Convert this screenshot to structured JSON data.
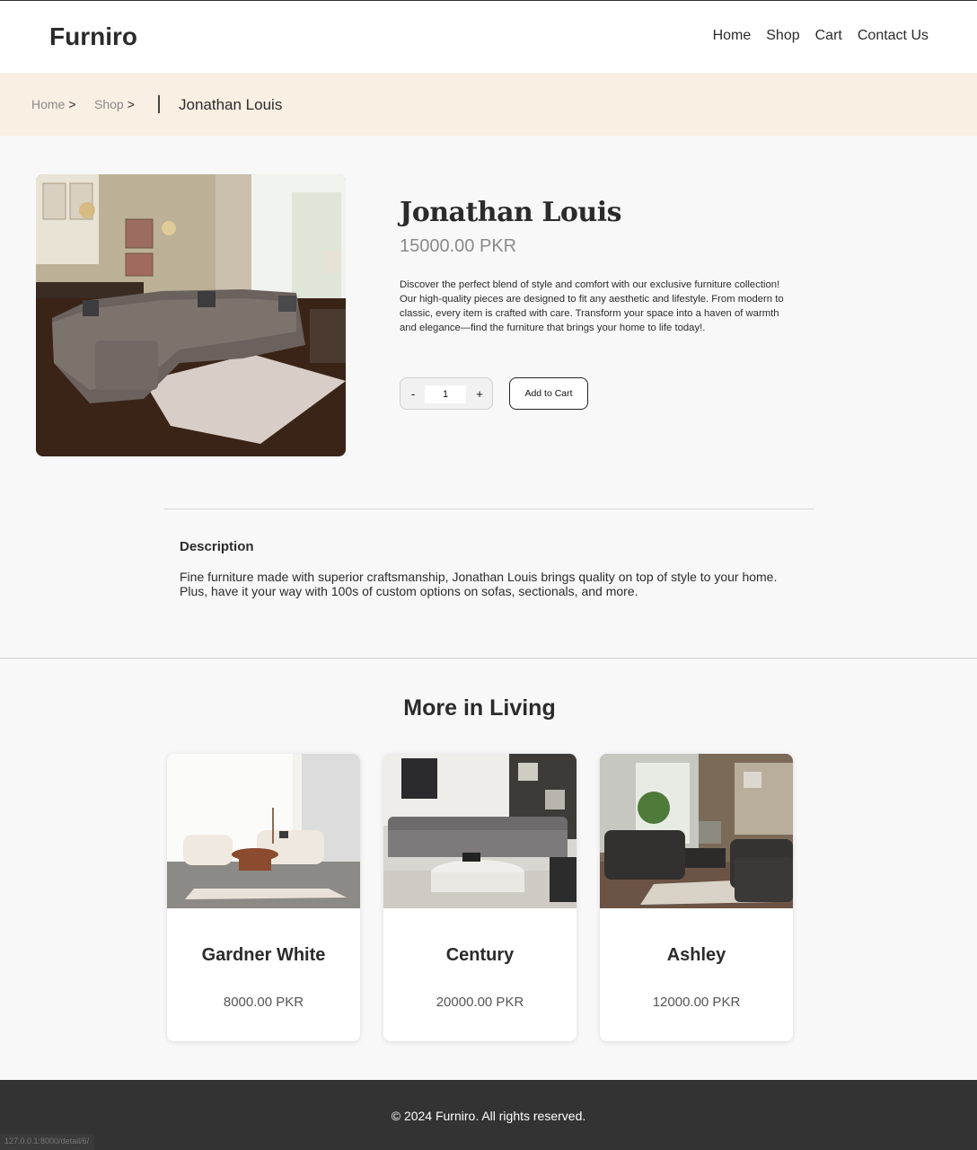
{
  "header": {
    "logo": "Furniro",
    "nav": [
      "Home",
      "Shop",
      "Cart",
      "Contact Us"
    ]
  },
  "breadcrumb": {
    "home": "Home",
    "shop": "Shop",
    "separator": ">",
    "current": "Jonathan Louis"
  },
  "product": {
    "title": "Jonathan Louis",
    "price": "15000.00 PKR",
    "summary": "Discover the perfect blend of style and comfort with our exclusive furniture collection! Our high-quality pieces are designed to fit any aesthetic and lifestyle. From modern to classic, every item is crafted with care. Transform your space into a haven of warmth and elegance—find the furniture that brings your home to life today!.",
    "quantity": {
      "minus": "-",
      "value": "1",
      "plus": "+"
    },
    "add_to_cart": "Add to Cart"
  },
  "description": {
    "heading": "Description",
    "body": "Fine furniture made with superior craftsmanship, Jonathan Louis brings quality on top of style to your home. Plus, have it your way with 100s of custom options on sofas, sectionals, and more."
  },
  "related": {
    "title": "More in Living",
    "items": [
      {
        "name": "Gardner White",
        "price": "8000.00 PKR"
      },
      {
        "name": "Century",
        "price": "20000.00 PKR"
      },
      {
        "name": "Ashley",
        "price": "12000.00 PKR"
      }
    ]
  },
  "footer": {
    "copyright": "© 2024 Furniro. All rights reserved."
  },
  "status_bar": {
    "url": "127.0.0.1:8000/detail/6/"
  },
  "colors": {
    "breadcrumb_bg": "#f9efe2",
    "page_bg": "#f8f8f8",
    "footer_bg": "#333333",
    "price_text": "#8a8a8a"
  }
}
